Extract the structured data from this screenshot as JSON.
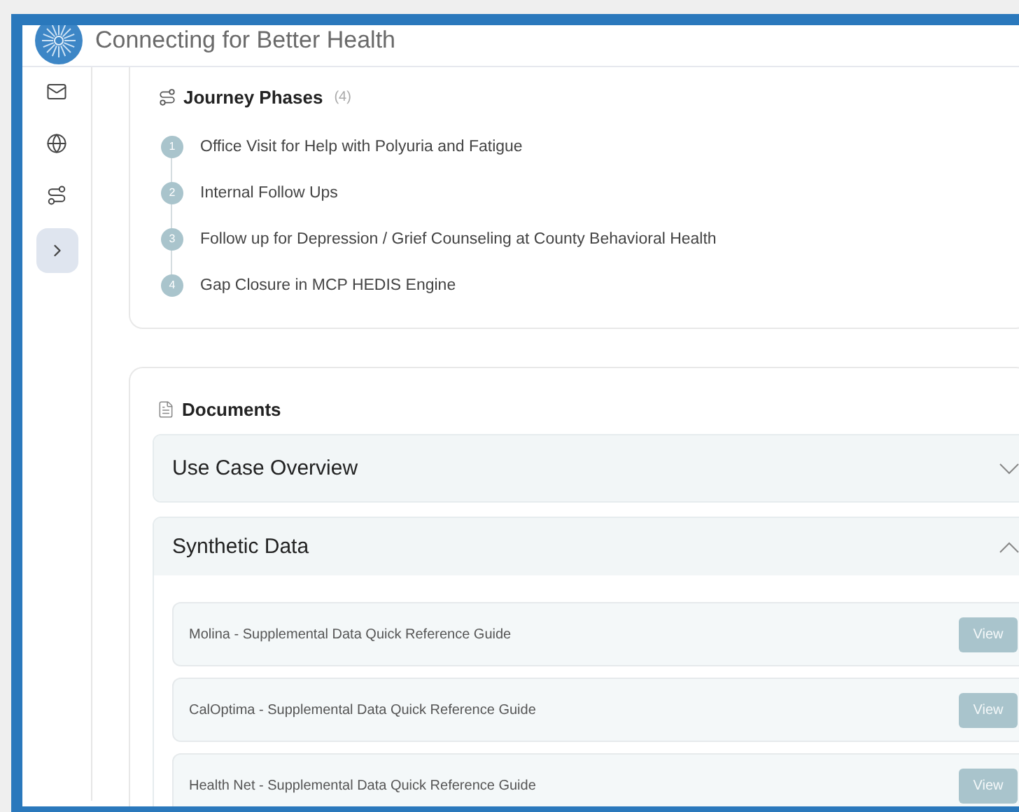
{
  "header": {
    "title": "Connecting for Better Health"
  },
  "journey": {
    "title": "Journey Phases",
    "count": "(4)",
    "phases": [
      {
        "number": "1",
        "label": "Office Visit for Help with Polyuria and Fatigue"
      },
      {
        "number": "2",
        "label": "Internal Follow Ups"
      },
      {
        "number": "3",
        "label": "Follow up for Depression / Grief Counseling at County Behavioral Health"
      },
      {
        "number": "4",
        "label": "Gap Closure in MCP HEDIS Engine"
      }
    ]
  },
  "documents": {
    "title": "Documents",
    "sections": [
      {
        "title": "Use Case Overview",
        "expanded": false
      },
      {
        "title": "Synthetic Data",
        "expanded": true,
        "items": [
          {
            "label": "Molina - Supplemental Data Quick Reference Guide",
            "button": "View"
          },
          {
            "label": "CalOptima - Supplemental Data Quick Reference Guide",
            "button": "View"
          },
          {
            "label": "Health Net - Supplemental Data Quick Reference Guide",
            "button": "View"
          }
        ]
      }
    ]
  }
}
